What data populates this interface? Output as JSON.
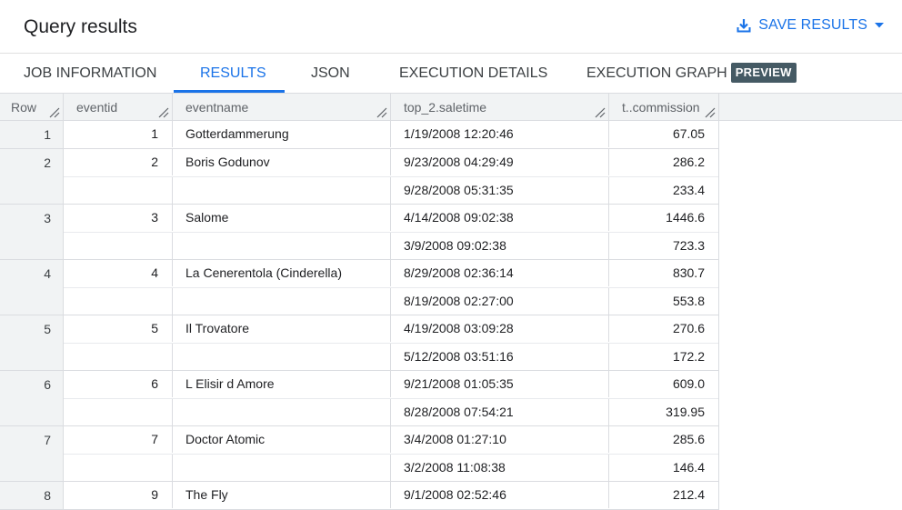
{
  "header": {
    "title": "Query results",
    "save_label": "SAVE RESULTS",
    "accent_color": "#1a73e8"
  },
  "tabs": [
    {
      "label": "JOB INFORMATION",
      "active": false
    },
    {
      "label": "RESULTS",
      "active": true
    },
    {
      "label": "JSON",
      "active": false
    },
    {
      "label": "EXECUTION DETAILS",
      "active": false
    },
    {
      "label": "EXECUTION GRAPH",
      "active": false,
      "badge": "PREVIEW"
    }
  ],
  "table": {
    "columns": [
      "Row",
      "eventid",
      "eventname",
      "top_2.saletime",
      "t..commission"
    ],
    "rows": [
      {
        "row": "1",
        "eventid": "1",
        "eventname": "Gotterdammerung",
        "subrows": [
          {
            "saletime": "1/19/2008 12:20:46",
            "commission": "67.05"
          }
        ]
      },
      {
        "row": "2",
        "eventid": "2",
        "eventname": "Boris Godunov",
        "subrows": [
          {
            "saletime": "9/23/2008 04:29:49",
            "commission": "286.2"
          },
          {
            "saletime": "9/28/2008 05:31:35",
            "commission": "233.4"
          }
        ]
      },
      {
        "row": "3",
        "eventid": "3",
        "eventname": "Salome",
        "subrows": [
          {
            "saletime": "4/14/2008 09:02:38",
            "commission": "1446.6"
          },
          {
            "saletime": "3/9/2008 09:02:38",
            "commission": "723.3"
          }
        ]
      },
      {
        "row": "4",
        "eventid": "4",
        "eventname": "La Cenerentola (Cinderella)",
        "subrows": [
          {
            "saletime": "8/29/2008 02:36:14",
            "commission": "830.7"
          },
          {
            "saletime": "8/19/2008 02:27:00",
            "commission": "553.8"
          }
        ]
      },
      {
        "row": "5",
        "eventid": "5",
        "eventname": "Il Trovatore",
        "subrows": [
          {
            "saletime": "4/19/2008 03:09:28",
            "commission": "270.6"
          },
          {
            "saletime": "5/12/2008 03:51:16",
            "commission": "172.2"
          }
        ]
      },
      {
        "row": "6",
        "eventid": "6",
        "eventname": "L Elisir d Amore",
        "subrows": [
          {
            "saletime": "9/21/2008 01:05:35",
            "commission": "609.0"
          },
          {
            "saletime": "8/28/2008 07:54:21",
            "commission": "319.95"
          }
        ]
      },
      {
        "row": "7",
        "eventid": "7",
        "eventname": "Doctor Atomic",
        "subrows": [
          {
            "saletime": "3/4/2008 01:27:10",
            "commission": "285.6"
          },
          {
            "saletime": "3/2/2008 11:08:38",
            "commission": "146.4"
          }
        ]
      },
      {
        "row": "8",
        "eventid": "9",
        "eventname": "The Fly",
        "subrows": [
          {
            "saletime": "9/1/2008 02:52:46",
            "commission": "212.4"
          }
        ]
      }
    ]
  }
}
